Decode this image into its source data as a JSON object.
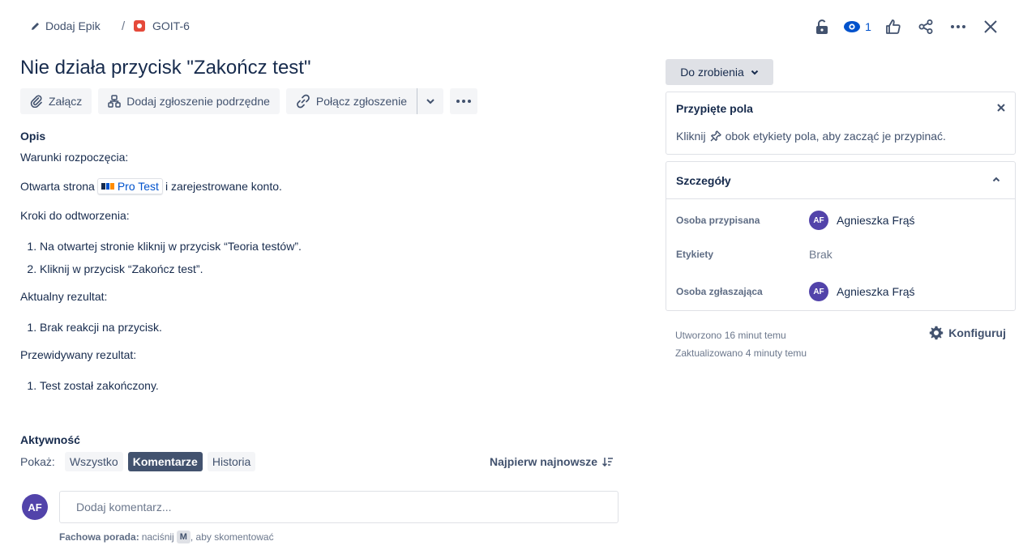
{
  "breadcrumb": {
    "epic_label": "Dodaj Epik",
    "separator": "/",
    "issue_key": "GOIT-6"
  },
  "toolbar": {
    "watch_count": "1"
  },
  "issue": {
    "title": "Nie działa przycisk \"Zakończ test\""
  },
  "actions": {
    "attach": "Załącz",
    "add_child": "Dodaj zgłoszenie podrzędne",
    "link_issue": "Połącz zgłoszenie"
  },
  "description": {
    "label": "Opis",
    "preconditions_heading": "Warunki rozpoczęcia:",
    "preconditions_prefix": "Otwarta strona",
    "preconditions_link": "Pro Test",
    "preconditions_suffix": " i zarejestrowane konto.",
    "steps_heading": "Kroki do odtworzenia:",
    "steps": [
      "Na otwartej stronie kliknij w przycisk “Teoria testów”.",
      "Kliknij w przycisk “Zakończ test”."
    ],
    "actual_heading": "Aktualny rezultat:",
    "actual": [
      "Brak reakcji na przycisk."
    ],
    "expected_heading": "Przewidywany rezultat:",
    "expected": [
      "Test został zakończony."
    ]
  },
  "activity": {
    "title": "Aktywność",
    "show_label": "Pokaż:",
    "filters": [
      "Wszystko",
      "Komentarze",
      "Historia"
    ],
    "active_filter": "Komentarze",
    "sort_label": "Najpierw najnowsze",
    "avatar_initials": "AF",
    "comment_placeholder": "Dodaj komentarz...",
    "tip_bold": "Fachowa porada:",
    "tip_text_before": "naciśnij",
    "tip_key": "M",
    "tip_text_after": ", aby skomentować"
  },
  "sidebar": {
    "status": "Do zrobienia",
    "pinned": {
      "title": "Przypięte pola",
      "text_before": "Kliknij",
      "text_after": "obok etykiety pola, aby zacząć je przypinać."
    },
    "details": {
      "title": "Szczegóły",
      "fields": [
        {
          "label": "Osoba przypisana",
          "value": "Agnieszka Frąś",
          "initials": "AF"
        },
        {
          "label": "Etykiety",
          "value": "Brak"
        },
        {
          "label": "Osoba zgłaszająca",
          "value": "Agnieszka Frąś",
          "initials": "AF"
        }
      ]
    },
    "created": "Utworzono 16 minut temu",
    "updated": "Zaktualizowano 4 minuty temu",
    "configure": "Konfiguruj"
  },
  "colors": {
    "accent": "#0052cc",
    "avatar": "#5243aa",
    "bug": "#e5493a",
    "active_chip": "#42526e"
  }
}
